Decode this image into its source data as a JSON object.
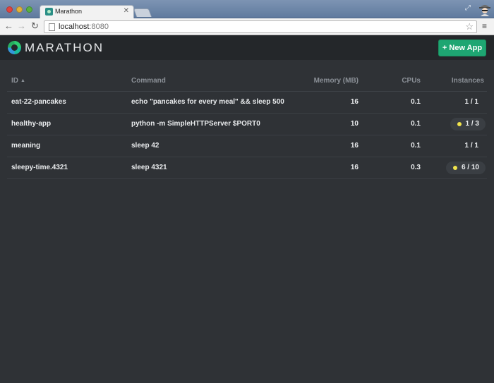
{
  "browser": {
    "tab_title": "Marathon",
    "url_host": "localhost",
    "url_port": ":8080"
  },
  "header": {
    "logo_text": "MARATHON",
    "new_app_label": "+ New App"
  },
  "table": {
    "columns": {
      "id": "ID",
      "command": "Command",
      "memory": "Memory (MB)",
      "cpus": "CPUs",
      "instances": "Instances"
    },
    "rows": [
      {
        "id": "eat-22-pancakes",
        "command": "echo \"pancakes for every meal\" && sleep 500",
        "memory": "16",
        "cpus": "0.1",
        "instances": "1 / 1",
        "status": ""
      },
      {
        "id": "healthy-app",
        "command": "python -m SimpleHTTPServer $PORT0",
        "memory": "10",
        "cpus": "0.1",
        "instances": "1 / 3",
        "status": "deploying"
      },
      {
        "id": "meaning",
        "command": "sleep 42",
        "memory": "16",
        "cpus": "0.1",
        "instances": "1 / 1",
        "status": ""
      },
      {
        "id": "sleepy-time.4321",
        "command": "sleep 4321",
        "memory": "16",
        "cpus": "0.3",
        "instances": "6 / 10",
        "status": "deploying"
      }
    ]
  },
  "colors": {
    "accent": "#1ea672",
    "status_deploying": "#f1e44c",
    "background": "#2f3236"
  }
}
